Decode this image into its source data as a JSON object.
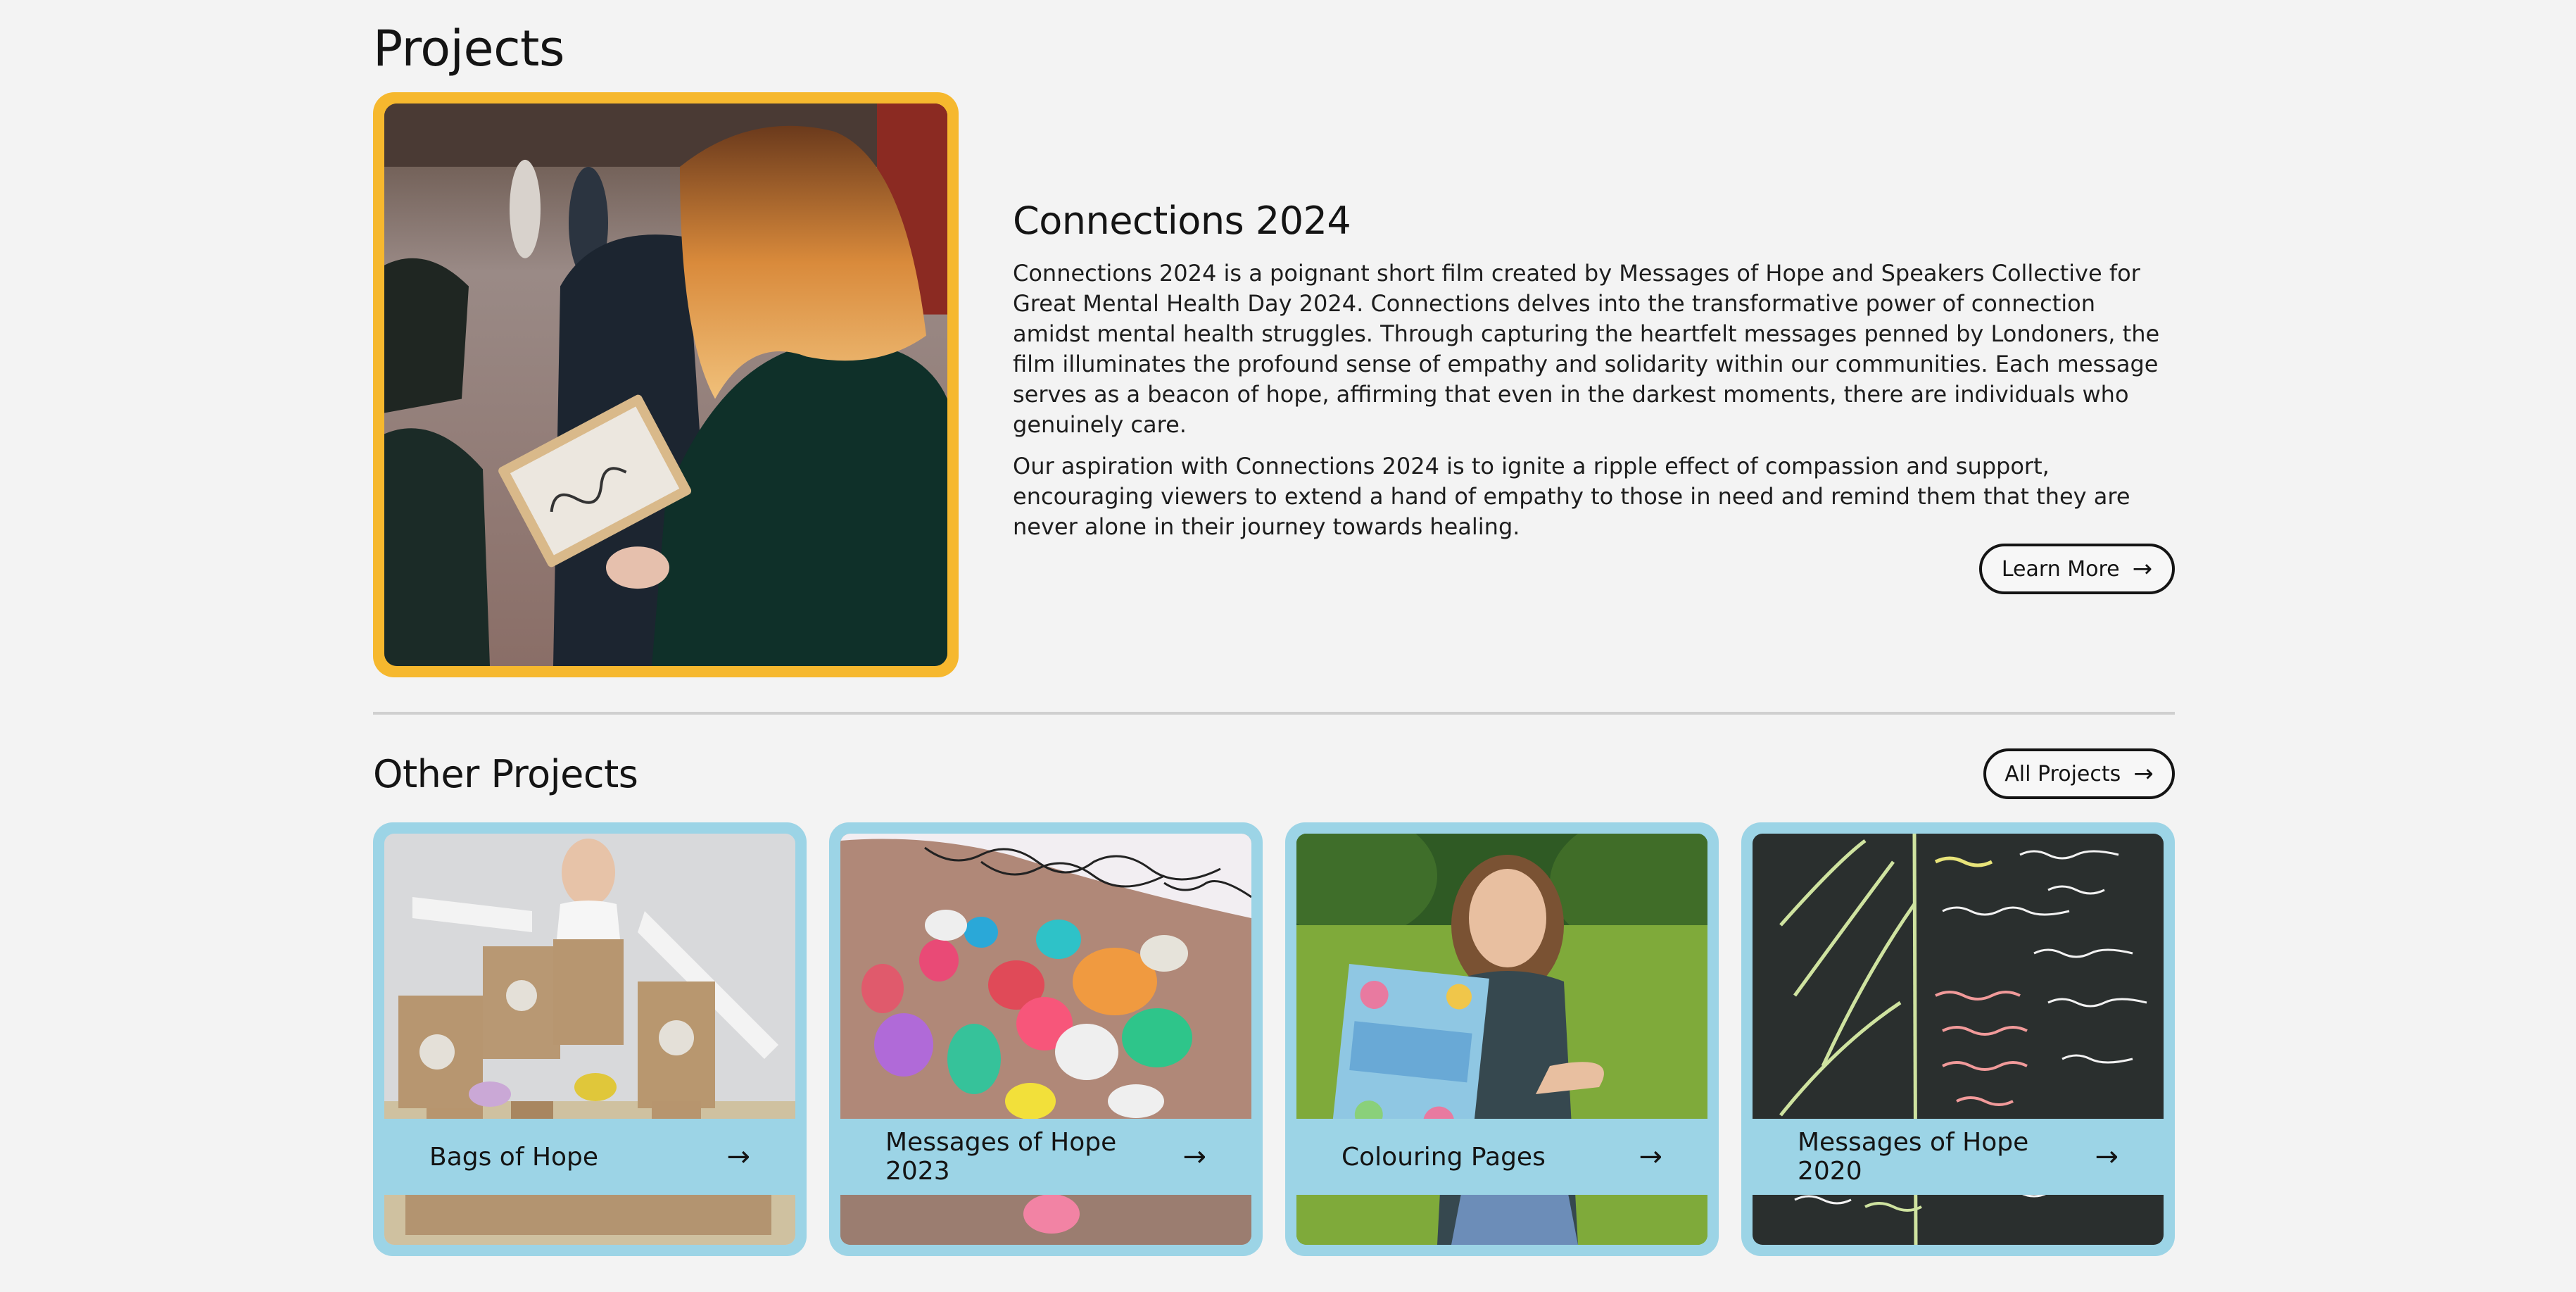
{
  "header": {
    "title": "Projects"
  },
  "featured": {
    "title": "Connections 2024",
    "paragraphs": [
      "Connections 2024 is a poignant short film created by Messages of Hope and Speakers Collective for Great Mental Health Day 2024. Connections delves into the transformative power of connection amidst mental health struggles. Through capturing the heartfelt messages penned by Londoners, the film illuminates the profound sense of empathy and solidarity within our communities. Each message serves as a beacon of hope, affirming that even in the darkest moments, there are individuals who genuinely care.",
      "Our aspiration with Connections 2024 is to ignite a ripple effect of compassion and support, encouraging viewers to extend a hand of empathy to those in need and remind them that they are never alone in their journey towards healing."
    ],
    "button_label": "Learn More",
    "frame_color": "#f6b82e"
  },
  "other": {
    "title": "Other Projects",
    "all_button_label": "All Projects",
    "card_color": "#9cd4e6",
    "cards": [
      {
        "label": "Bags of Hope"
      },
      {
        "label": "Messages of Hope 2023"
      },
      {
        "label": "Colouring Pages"
      },
      {
        "label": "Messages of Hope 2020"
      }
    ]
  },
  "icons": {
    "arrow": "arrow-right-icon",
    "arrow_glyph": "→"
  }
}
